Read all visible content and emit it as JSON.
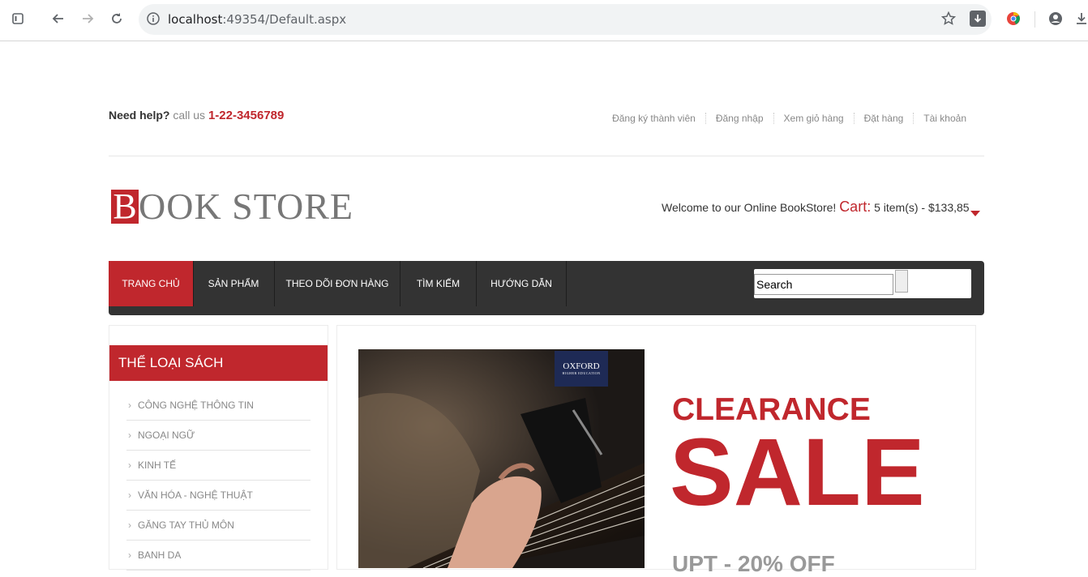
{
  "browser": {
    "url_host": "localhost",
    "url_rest": ":49354/Default.aspx"
  },
  "header": {
    "help_label": "Need help?",
    "call_label": "call us",
    "phone": "1-22-3456789",
    "links": [
      "Đăng ký thành viên",
      "Đăng nhập",
      "Xem giỏ hàng",
      "Đặt hàng",
      "Tài khoản"
    ],
    "logo_first": "B",
    "logo_rest": "OOK STORE",
    "welcome": "Welcome to our Online BookStore!",
    "cart_label": "Cart:",
    "cart_summary": "5 item(s) - $133,85"
  },
  "nav": {
    "items": [
      "TRANG CHỦ",
      "SẢN PHẨM",
      "THEO DÕI ĐƠN HÀNG",
      "TÌM KIẾM",
      "HƯỚNG DẪN"
    ],
    "search_value": "Search"
  },
  "sidebar": {
    "title": "THỂ LOẠI SÁCH",
    "categories": [
      "CÔNG NGHỆ THÔNG TIN",
      "NGOẠI NGỮ",
      "KINH TẾ",
      "VĂN HÓA - NGHỆ THUẬT",
      "GĂNG TAY THỦ MÔN",
      "BANH DA"
    ]
  },
  "banner": {
    "oxford": "OXFORD",
    "oxford_sub": "HIGHER EDUCATION",
    "line1": "CLEARANCE",
    "line2": "SALE",
    "line3": "UPT - 20% OFF"
  },
  "colors": {
    "accent": "#c0272d",
    "nav_bg": "#333333"
  }
}
